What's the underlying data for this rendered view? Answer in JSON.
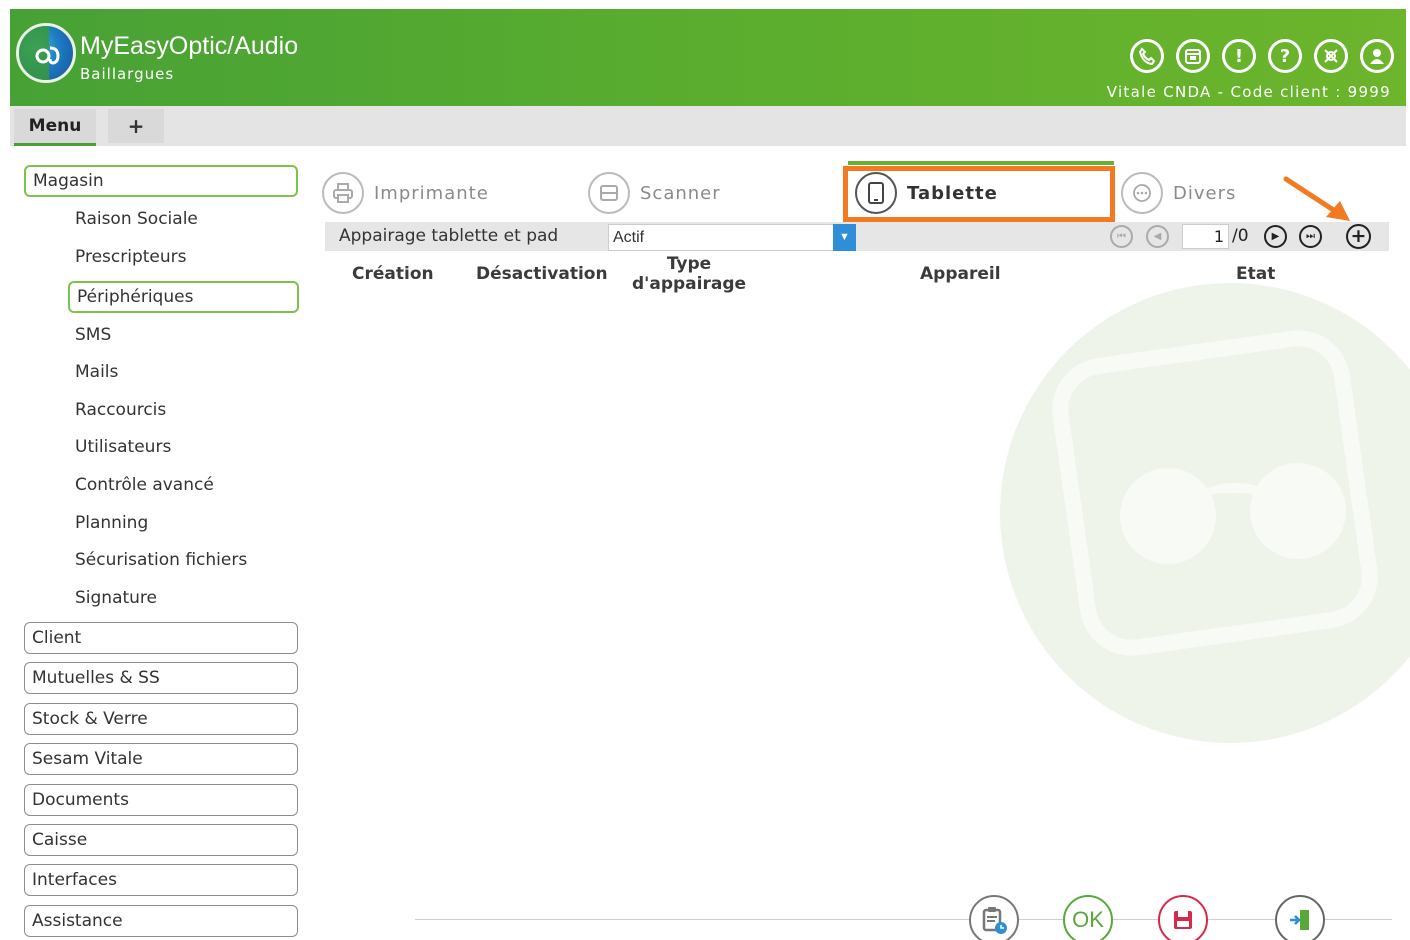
{
  "header": {
    "app_title": "MyEasyOptic/Audio",
    "subtitle": "Baillargues",
    "info": "Vitale CNDA - Code client : 9999",
    "icons": [
      "phone-icon",
      "calendar-icon",
      "alert-icon",
      "help-icon",
      "support-icon",
      "user-icon"
    ]
  },
  "tabs": {
    "menu": "Menu",
    "add": "+"
  },
  "sidebar": {
    "groups_top": {
      "magasin": "Magasin"
    },
    "sub_items": [
      "Raison Sociale",
      "Prescripteurs",
      "Périphériques",
      "SMS",
      "Mails",
      "Raccourcis",
      "Utilisateurs",
      "Contrôle avancé",
      "Planning",
      "Sécurisation fichiers",
      "Signature"
    ],
    "groups": [
      "Client",
      "Mutuelles & SS",
      "Stock & Verre",
      "Sesam Vitale",
      "Documents",
      "Caisse",
      "Interfaces",
      "Assistance"
    ]
  },
  "peripheral_tabs": [
    "Imprimante",
    "Scanner",
    "Tablette",
    "Divers"
  ],
  "selected_tab": "Tablette",
  "toolbar": {
    "label": "Appairage tablette et pad",
    "status_value": "Actif",
    "page": "1",
    "total": "/0"
  },
  "table": {
    "columns": [
      "Création",
      "Désactivation",
      "Type d'appairage",
      "Appareil",
      "Etat"
    ],
    "column_type_line1": "Type",
    "column_type_line2": "d'appairage",
    "rows": []
  },
  "footer": {
    "ok_label": "OK"
  },
  "colors": {
    "brand_green": "#4ca532",
    "highlight_orange": "#f27a22",
    "select_blue": "#2e8ed8"
  }
}
